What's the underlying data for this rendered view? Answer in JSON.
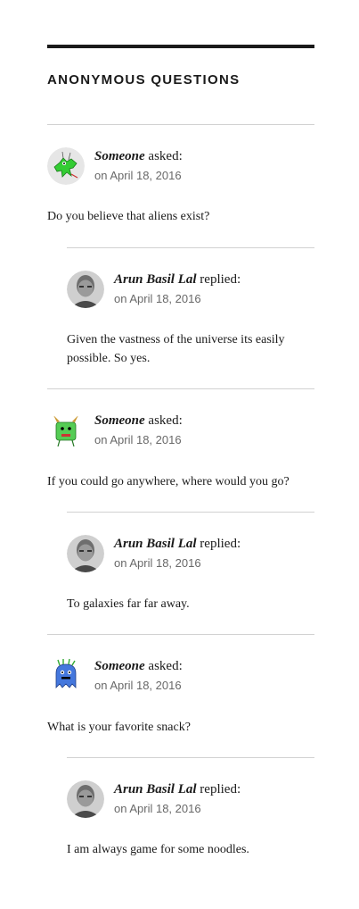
{
  "widget": {
    "title": "ANONYMOUS QUESTIONS"
  },
  "threads": [
    {
      "question": {
        "author": "Someone",
        "verb": "asked:",
        "date": "on April 18, 2016",
        "text": "Do you believe that aliens exist?",
        "avatar": "green-alien-avatar"
      },
      "reply": {
        "author": "Arun Basil Lal",
        "verb": "replied:",
        "date": "on April 18, 2016",
        "text": "Given the vastness of the universe its easily possible. So yes.",
        "avatar": "user-photo-avatar"
      }
    },
    {
      "question": {
        "author": "Someone",
        "verb": "asked:",
        "date": "on April 18, 2016",
        "text": "If you could go anywhere, where would you go?",
        "avatar": "green-monster-avatar"
      },
      "reply": {
        "author": "Arun Basil Lal",
        "verb": "replied:",
        "date": "on April 18, 2016",
        "text": "To galaxies far far away.",
        "avatar": "user-photo-avatar"
      }
    },
    {
      "question": {
        "author": "Someone",
        "verb": "asked:",
        "date": "on April 18, 2016",
        "text": "What is your favorite snack?",
        "avatar": "blue-monster-avatar"
      },
      "reply": {
        "author": "Arun Basil Lal",
        "verb": "replied:",
        "date": "on April 18, 2016",
        "text": "I am always game for some noodles.",
        "avatar": "user-photo-avatar"
      }
    }
  ]
}
